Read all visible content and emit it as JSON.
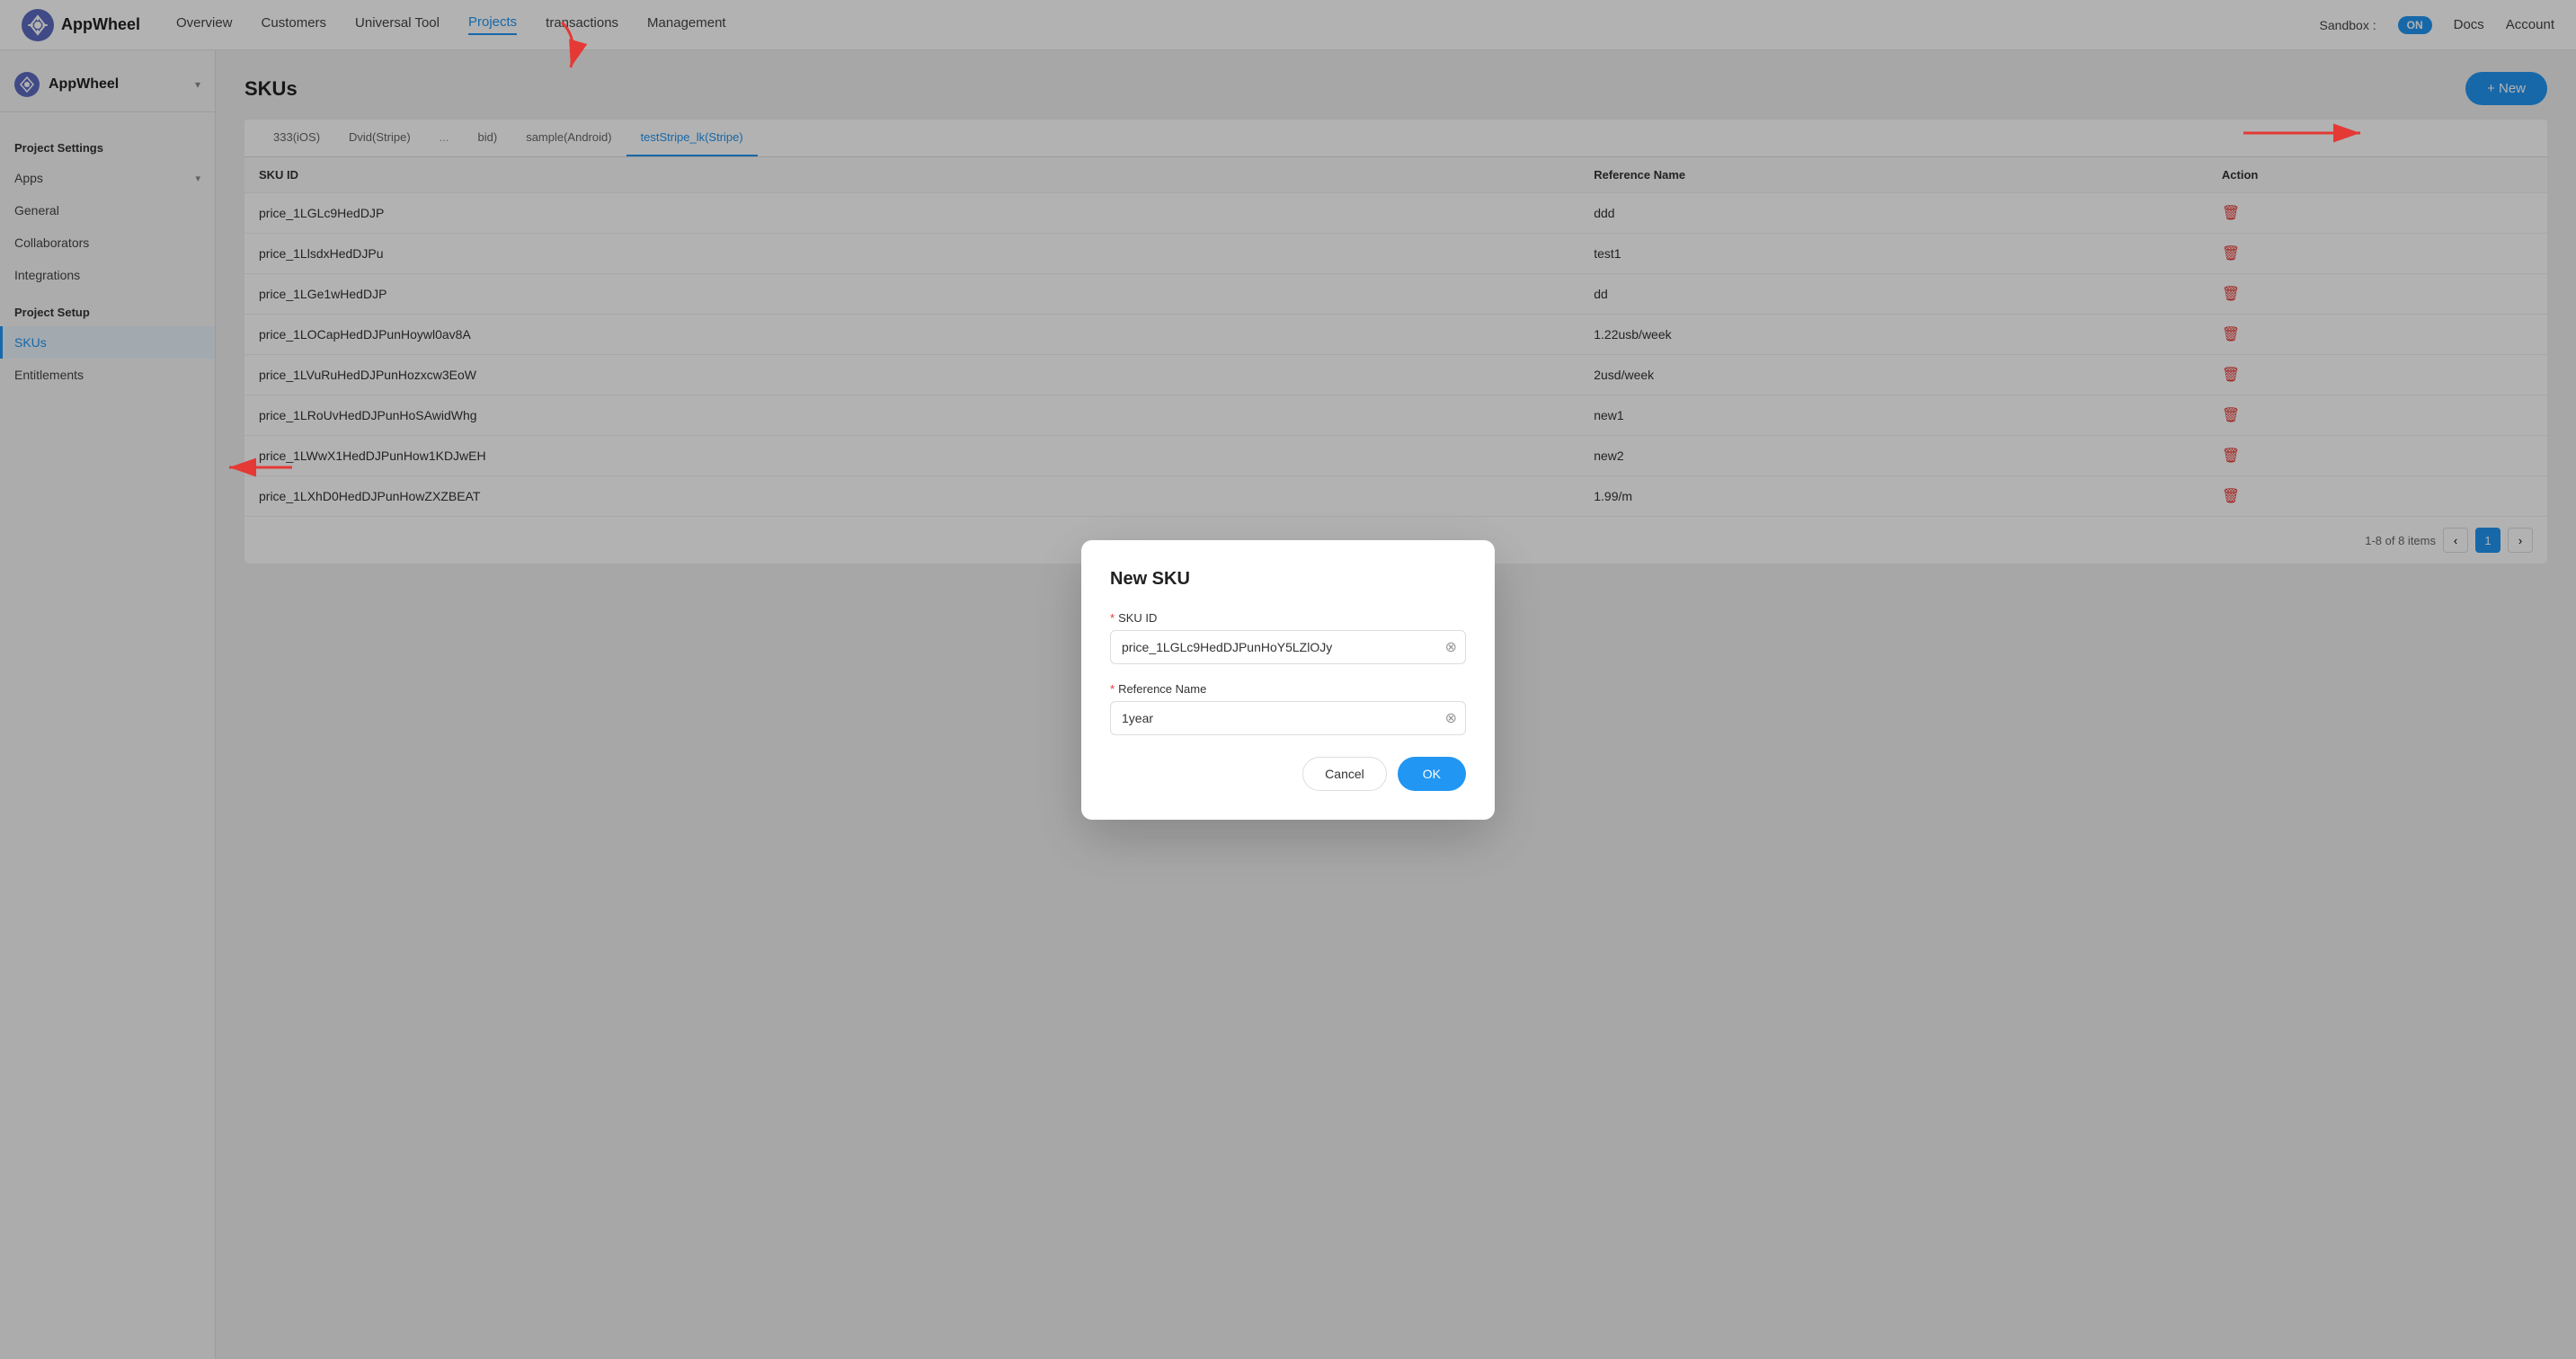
{
  "app": {
    "name": "AppWheel"
  },
  "nav": {
    "links": [
      {
        "id": "overview",
        "label": "Overview",
        "active": false
      },
      {
        "id": "customers",
        "label": "Customers",
        "active": false
      },
      {
        "id": "universal-tool",
        "label": "Universal Tool",
        "active": false
      },
      {
        "id": "projects",
        "label": "Projects",
        "active": true
      },
      {
        "id": "transactions",
        "label": "transactions",
        "active": false
      },
      {
        "id": "management",
        "label": "Management",
        "active": false
      }
    ],
    "sandbox_label": "Sandbox :",
    "sandbox_toggle": "ON",
    "docs": "Docs",
    "account": "Account"
  },
  "sidebar": {
    "project_name": "AppWheel",
    "project_settings_title": "Project Settings",
    "project_settings_items": [
      {
        "id": "apps",
        "label": "Apps",
        "has_arrow": true
      },
      {
        "id": "general",
        "label": "General",
        "has_arrow": false
      },
      {
        "id": "collaborators",
        "label": "Collaborators",
        "has_arrow": false
      },
      {
        "id": "integrations",
        "label": "Integrations",
        "has_arrow": false
      }
    ],
    "project_setup_title": "Project Setup",
    "project_setup_items": [
      {
        "id": "skus",
        "label": "SKUs",
        "active": true
      },
      {
        "id": "entitlements",
        "label": "Entitlements",
        "active": false
      }
    ]
  },
  "page": {
    "title": "SKUs",
    "new_button": "+ New"
  },
  "tabs": [
    {
      "id": "ios",
      "label": "333(iOS)",
      "active": false
    },
    {
      "id": "dvid-stripe",
      "label": "Dvid(Stripe)",
      "active": false
    },
    {
      "id": "placeholder",
      "label": "...",
      "active": false
    },
    {
      "id": "bid",
      "label": "bid)",
      "active": false
    },
    {
      "id": "sample-android",
      "label": "sample(Android)",
      "active": false
    },
    {
      "id": "test-stripe",
      "label": "testStripe_lk(Stripe)",
      "active": true
    }
  ],
  "table": {
    "columns": [
      {
        "id": "sku-id",
        "label": "SKU ID"
      },
      {
        "id": "reference-name",
        "label": "Reference Name"
      },
      {
        "id": "action",
        "label": "Action"
      }
    ],
    "rows": [
      {
        "sku_id": "price_1LGLc9HedDJP",
        "reference_name": "ddd"
      },
      {
        "sku_id": "price_1LlsdxHedDJPu",
        "reference_name": "test1"
      },
      {
        "sku_id": "price_1LGe1wHedDJP",
        "reference_name": "dd"
      },
      {
        "sku_id": "price_1LOCapHedDJPunHoywl0av8A",
        "reference_name": "1.22usb/week"
      },
      {
        "sku_id": "price_1LVuRuHedDJPunHozxcw3EoW",
        "reference_name": "2usd/week"
      },
      {
        "sku_id": "price_1LRoUvHedDJPunHoSAwidWhg",
        "reference_name": "new1"
      },
      {
        "sku_id": "price_1LWwX1HedDJPunHow1KDJwEH",
        "reference_name": "new2"
      },
      {
        "sku_id": "price_1LXhD0HedDJPunHowZXZBEAT",
        "reference_name": "1.99/m"
      }
    ],
    "pagination": {
      "summary": "1-8 of 8 items",
      "current_page": 1
    }
  },
  "modal": {
    "title": "New SKU",
    "sku_id_label": "SKU ID",
    "sku_id_value": "price_1LGLc9HedDJPunHoY5LZlOJy",
    "reference_name_label": "Reference Name",
    "reference_name_value": "1year",
    "cancel_btn": "Cancel",
    "ok_btn": "OK"
  }
}
